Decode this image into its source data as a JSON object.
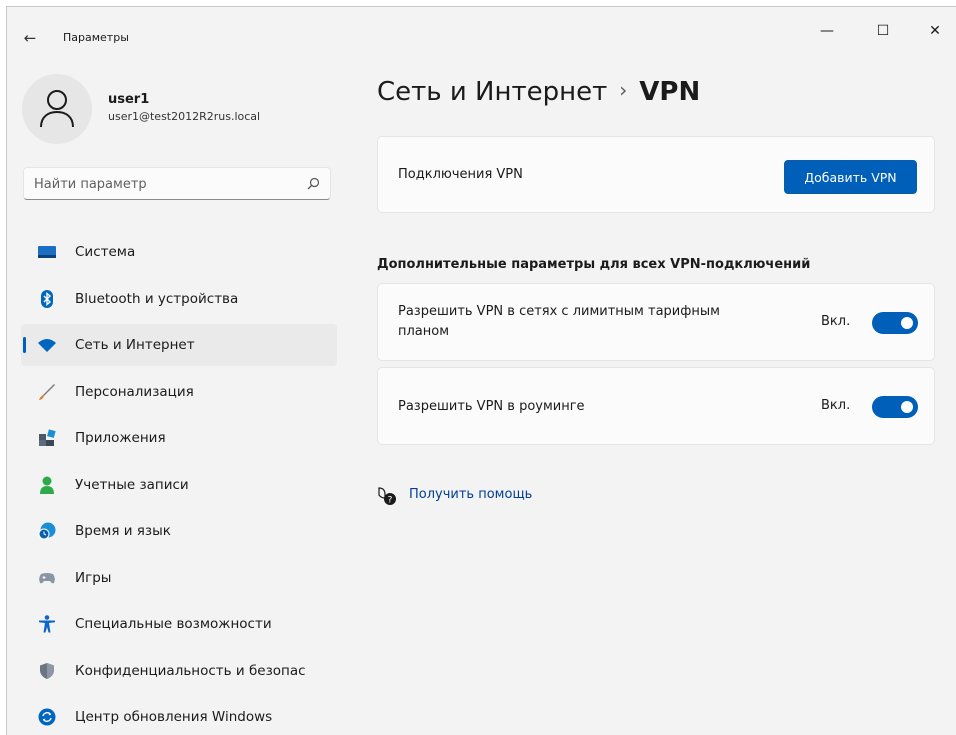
{
  "window": {
    "title": "Параметры",
    "controls": {
      "minimize": "—",
      "maximize": "☐",
      "close": "✕"
    }
  },
  "profile": {
    "name": "user1",
    "email": "user1@test2012R2rus.local"
  },
  "search": {
    "placeholder": "Найти параметр"
  },
  "sidebar": {
    "items": [
      {
        "label": "Система",
        "icon": "monitor-icon",
        "color": "#1a6fc4"
      },
      {
        "label": "Bluetooth и устройства",
        "icon": "bluetooth-icon",
        "color": "#0067c0"
      },
      {
        "label": "Сеть и Интернет",
        "icon": "wifi-icon",
        "color": "#0067c0",
        "active": true
      },
      {
        "label": "Персонализация",
        "icon": "brush-icon",
        "color": "#e07b18"
      },
      {
        "label": "Приложения",
        "icon": "apps-icon",
        "color": "#4a5a6a"
      },
      {
        "label": "Учетные записи",
        "icon": "person-icon",
        "color": "#2eaa4a"
      },
      {
        "label": "Время и язык",
        "icon": "globe-clock-icon",
        "color": "#1a8fd6"
      },
      {
        "label": "Игры",
        "icon": "gamepad-icon",
        "color": "#8a96a3"
      },
      {
        "label": "Специальные возможности",
        "icon": "accessibility-icon",
        "color": "#0e67c6"
      },
      {
        "label": "Конфиденциальность и безопас",
        "icon": "shield-icon",
        "color": "#6c7683"
      },
      {
        "label": "Центр обновления Windows",
        "icon": "update-icon",
        "color": "#0067c0"
      }
    ]
  },
  "breadcrumb": {
    "parent": "Сеть и Интернет",
    "separator": "›",
    "current": "VPN"
  },
  "vpn_connections": {
    "label": "Подключения VPN",
    "add_button": "Добавить VPN"
  },
  "advanced": {
    "title": "Дополнительные параметры для всех VPN-подключений",
    "metered": {
      "label": "Разрешить VPN в сетях с лимитным тарифным планом",
      "state": "Вкл.",
      "on": true
    },
    "roaming": {
      "label": "Разрешить VPN в роуминге",
      "state": "Вкл.",
      "on": true
    }
  },
  "help": {
    "label": "Получить помощь"
  },
  "colors": {
    "accent": "#005fb8",
    "background": "#f3f3f3",
    "card": "#fbfbfb"
  }
}
